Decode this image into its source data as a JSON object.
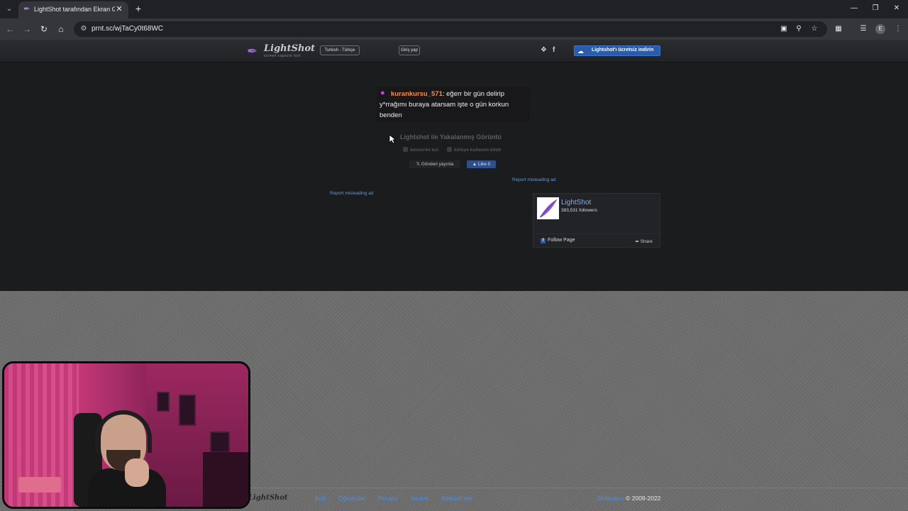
{
  "browser": {
    "tab_title": "LightShot tarafından Ekran Görü",
    "url": "prnt.sc/wjTaCy0t68WC",
    "profile_initial": "E",
    "icons": [
      "tab-list-icon",
      "favicon-feather-icon",
      "close-icon",
      "plus-icon",
      "minimize-icon",
      "restore-icon",
      "close-window-icon",
      "back-icon",
      "forward-icon",
      "reload-icon",
      "home-icon",
      "site-info-icon",
      "install-app-icon",
      "zoom-icon",
      "bookmark-star-icon",
      "extensions-icon",
      "media-icon",
      "menu-icon"
    ]
  },
  "header": {
    "logo_text": "LightShot",
    "logo_sub": "screen capture tool",
    "language": "Turkish - Türkçe",
    "login": "Giriş yap",
    "download_label": "Lightshot'ı ücretsiz indirin",
    "accent": "#2a5cab"
  },
  "screenshot": {
    "username": "kurankursu_571",
    "message": ": eğerr bir gün delirip y*rrağımı buraya atarsam işte o gün korkun benden"
  },
  "actions": {
    "caption": "Lightshot ile Yakalanmış Görüntü",
    "similar": "benzerini bul",
    "report_abuse": "kötüye kullanım bildir",
    "tweet": "Gönderi yayınla",
    "like": "Like 0",
    "report_ad_right": "Report misleading ad",
    "report_ad_left": "Report misleading ad"
  },
  "facebook": {
    "page_name": "LightShot",
    "followers": "383,531 followers",
    "follow": "Follow Page",
    "share": "Share"
  },
  "footer": {
    "logo": "LightShot",
    "links": [
      "İndir",
      "Öğreticiler",
      "Privacy",
      "Yardım",
      "Reklam Ver"
    ],
    "brand": "Skillbrains",
    "copyright": "© 2009-2022"
  }
}
